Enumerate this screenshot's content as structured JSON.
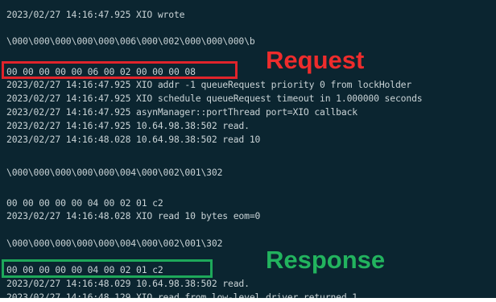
{
  "colors": {
    "terminal_bg": "#0b2530",
    "terminal_text": "#c9d3d6",
    "request_highlight": "#e0242b",
    "request_label": "#ee2c2c",
    "response_highlight": "#1ea85a",
    "response_label": "#22b35e"
  },
  "log": {
    "lines": [
      "2023/02/27 14:16:47.925 XIO wrote",
      "\\000\\000\\000\\000\\000\\006\\000\\002\\000\\000\\000\\b",
      "00 00 00 00 00 06 00 02 00 00 00 08",
      "2023/02/27 14:16:47.925 XIO addr -1 queueRequest priority 0 from lockHolder",
      "2023/02/27 14:16:47.925 XIO schedule queueRequest timeout in 1.000000 seconds",
      "2023/02/27 14:16:47.925 asynManager::portThread port=XIO callback",
      "2023/02/27 14:16:47.925 10.64.98.38:502 read.",
      "2023/02/27 14:16:48.028 10.64.98.38:502 read 10",
      "\\000\\000\\000\\000\\000\\004\\000\\002\\001\\302",
      "00 00 00 00 00 04 00 02 01 c2",
      "2023/02/27 14:16:48.028 XIO read 10 bytes eom=0",
      "\\000\\000\\000\\000\\000\\004\\000\\002\\001\\302",
      "00 00 00 00 00 04 00 02 01 c2",
      "2023/02/27 14:16:48.029 10.64.98.38:502 read.",
      "2023/02/27 14:16:48.129 XIO read from low-level driver returned 1"
    ]
  },
  "annotations": {
    "request_label": "Request",
    "response_label": "Response"
  }
}
